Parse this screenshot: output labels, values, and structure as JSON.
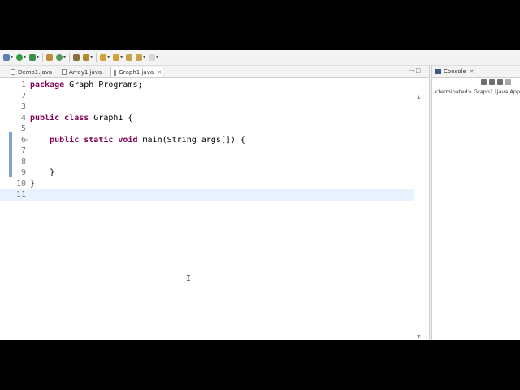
{
  "toolbar": {
    "icons": [
      "debug-icon",
      "run-icon",
      "external-tools-icon",
      "new-java-project-icon",
      "new-java-class-icon",
      "open-type-icon",
      "search-icon",
      "next-annotation-icon",
      "back-icon",
      "forward-icon"
    ]
  },
  "editor": {
    "tabs": [
      {
        "label": "Demo1.java",
        "active": false
      },
      {
        "label": "Array1.java",
        "active": false
      },
      {
        "label": "Graph1.java",
        "active": true
      }
    ],
    "lines": [
      {
        "num": "1",
        "segments": [
          {
            "t": "package",
            "kw": true
          },
          {
            "t": " Graph_Programs;",
            "kw": false
          }
        ]
      },
      {
        "num": "2",
        "segments": []
      },
      {
        "num": "3",
        "segments": []
      },
      {
        "num": "4",
        "segments": [
          {
            "t": "public",
            "kw": true
          },
          {
            "t": " ",
            "kw": false
          },
          {
            "t": "class",
            "kw": true
          },
          {
            "t": " Graph1 {",
            "kw": false
          }
        ]
      },
      {
        "num": "5",
        "segments": []
      },
      {
        "num": "6",
        "fold": true,
        "segments": [
          {
            "t": "    ",
            "kw": false
          },
          {
            "t": "public",
            "kw": true
          },
          {
            "t": " ",
            "kw": false
          },
          {
            "t": "static",
            "kw": true
          },
          {
            "t": " ",
            "kw": false
          },
          {
            "t": "void",
            "kw": true
          },
          {
            "t": " main(String args[]) {",
            "kw": false
          }
        ]
      },
      {
        "num": "7",
        "segments": []
      },
      {
        "num": "8",
        "segments": []
      },
      {
        "num": "9",
        "segments": [
          {
            "t": "    }",
            "kw": false
          }
        ]
      },
      {
        "num": "10",
        "segments": [
          {
            "t": "}",
            "kw": false
          }
        ]
      },
      {
        "num": "11",
        "current": true,
        "segments": []
      }
    ]
  },
  "console": {
    "title": "Console",
    "status": "<terminated> Graph1 [Java App"
  }
}
